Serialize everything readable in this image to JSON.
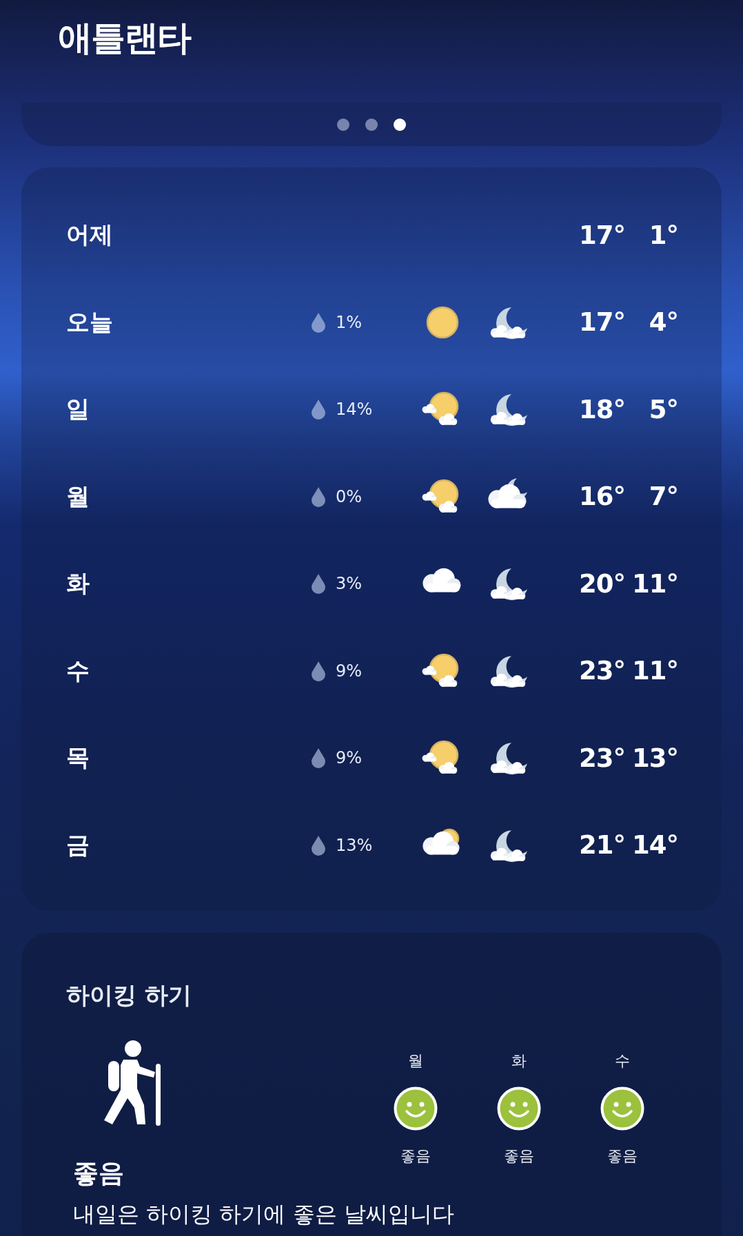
{
  "city": "애틀랜타",
  "pager": [
    {
      "selected": false
    },
    {
      "selected": false
    },
    {
      "selected": true
    }
  ],
  "forecast": [
    {
      "kind": "past",
      "day": "어제",
      "high": "17°",
      "low": "1°"
    },
    {
      "kind": "forecast",
      "day": "오늘",
      "precipitation": "1%",
      "day_icon": {
        "kind": "sun"
      },
      "night_icon": {
        "kind": "moon_cloud"
      },
      "high": "17°",
      "low": "4°"
    },
    {
      "kind": "forecast",
      "day": "일",
      "precipitation": "14%",
      "day_icon": {
        "kind": "sun_cloud"
      },
      "night_icon": {
        "kind": "moon_cloud"
      },
      "high": "18°",
      "low": "5°"
    },
    {
      "kind": "forecast",
      "day": "월",
      "precipitation": "0%",
      "day_icon": {
        "kind": "sun_cloud"
      },
      "night_icon": {
        "kind": "cloud_moon"
      },
      "high": "16°",
      "low": "7°"
    },
    {
      "kind": "forecast",
      "day": "화",
      "precipitation": "3%",
      "day_icon": {
        "kind": "cloud"
      },
      "night_icon": {
        "kind": "moon_cloud"
      },
      "high": "20°",
      "low": "11°"
    },
    {
      "kind": "forecast",
      "day": "수",
      "precipitation": "9%",
      "day_icon": {
        "kind": "sun_cloud"
      },
      "night_icon": {
        "kind": "moon_cloud"
      },
      "high": "23°",
      "low": "11°"
    },
    {
      "kind": "forecast",
      "day": "목",
      "precipitation": "9%",
      "day_icon": {
        "kind": "sun_cloud"
      },
      "night_icon": {
        "kind": "moon_cloud"
      },
      "high": "23°",
      "low": "13°"
    },
    {
      "kind": "forecast",
      "day": "금",
      "precipitation": "13%",
      "day_icon": {
        "kind": "cloud_sun"
      },
      "night_icon": {
        "kind": "moon_cloud"
      },
      "high": "21°",
      "low": "14°"
    }
  ],
  "hiking": {
    "title": "하이킹 하기",
    "rating": "좋음",
    "summary": "내일은 하이킹 하기에 좋은 날씨입니다",
    "days": [
      {
        "day": "월",
        "rating": "좋음"
      },
      {
        "day": "화",
        "rating": "좋음"
      },
      {
        "day": "수",
        "rating": "좋음"
      }
    ]
  }
}
